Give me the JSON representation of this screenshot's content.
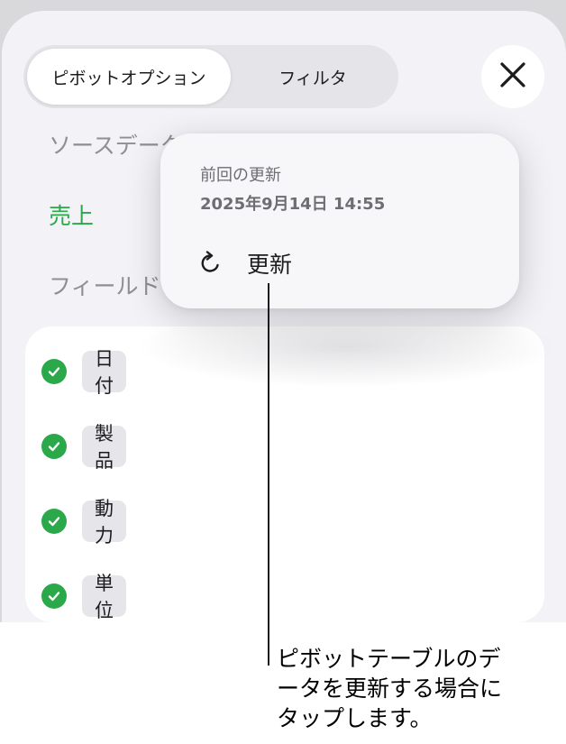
{
  "tabs": {
    "active": "ピボットオプション",
    "inactive": "フィルタ"
  },
  "source_label": "ソースデータ",
  "source_value": "売上",
  "fields_label": "フィールド",
  "fields": [
    {
      "label": "日付",
      "checked": true
    },
    {
      "label": "製品",
      "checked": true
    },
    {
      "label": "動力",
      "checked": true
    },
    {
      "label": "単位",
      "checked": true
    }
  ],
  "popover": {
    "title": "前回の更新",
    "date": "2025年9月14日 14:55",
    "action_label": "更新"
  },
  "callout": {
    "line1": "ピボットテーブルのデ",
    "line2": "ータを更新する場合に",
    "line3": "タップします。"
  },
  "colors": {
    "accent_green": "#2ba84a",
    "sheet_bg": "#f2f2f7",
    "chip_bg": "#e5e5ea"
  },
  "icons": {
    "close": "close-icon",
    "check": "checkmark-circle-icon",
    "refresh": "refresh-icon"
  }
}
